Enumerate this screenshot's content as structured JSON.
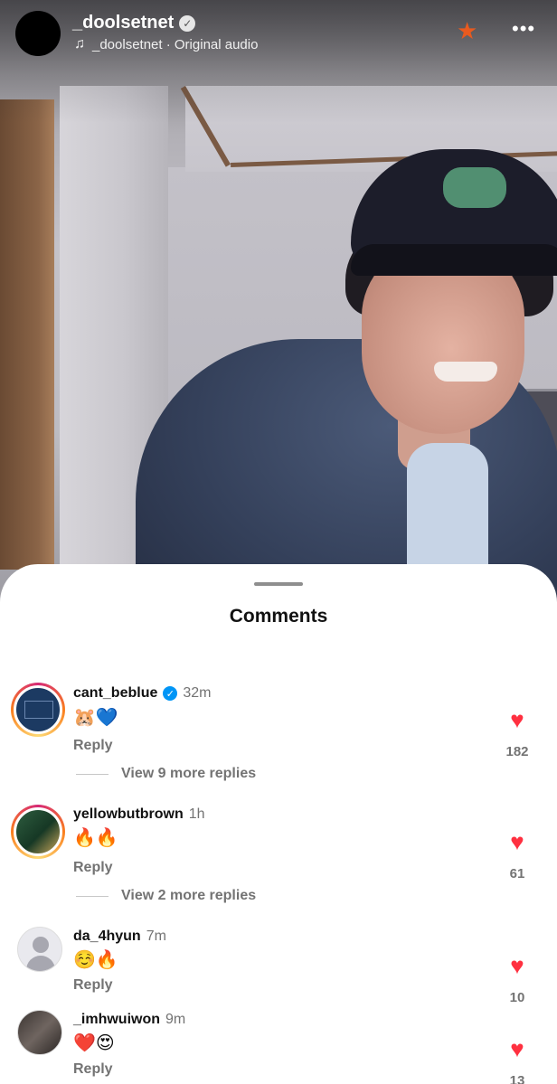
{
  "header": {
    "username": "_doolsetnet",
    "verified_icon": "verified-badge-icon",
    "audio_label": "_doolsetnet · Original audio",
    "icons": [
      "music-note-icon",
      "star-icon",
      "more-options-icon"
    ]
  },
  "sheet": {
    "title": "Comments"
  },
  "comments": [
    {
      "username": "cant_beblue",
      "time": "32m",
      "verified": true,
      "text": "🐹💙",
      "reply_label": "Reply",
      "likes": "182",
      "view_replies": "View 9 more replies"
    },
    {
      "username": "yellowbutbrown",
      "time": "1h",
      "verified": false,
      "text": "🔥🔥",
      "reply_label": "Reply",
      "likes": "61",
      "view_replies": "View 2 more replies"
    },
    {
      "username": "da_4hyun",
      "time": "7m",
      "verified": false,
      "text": "☺️🔥",
      "reply_label": "Reply",
      "likes": "10"
    },
    {
      "username": "_imhwuiwon",
      "time": "9m",
      "verified": false,
      "text": "❤️😍",
      "reply_label": "Reply",
      "likes": "13"
    }
  ],
  "colors": {
    "heart": "#ff3040",
    "verified": "#0095f6",
    "muted_text": "#737373",
    "star": "#e85a1f"
  }
}
